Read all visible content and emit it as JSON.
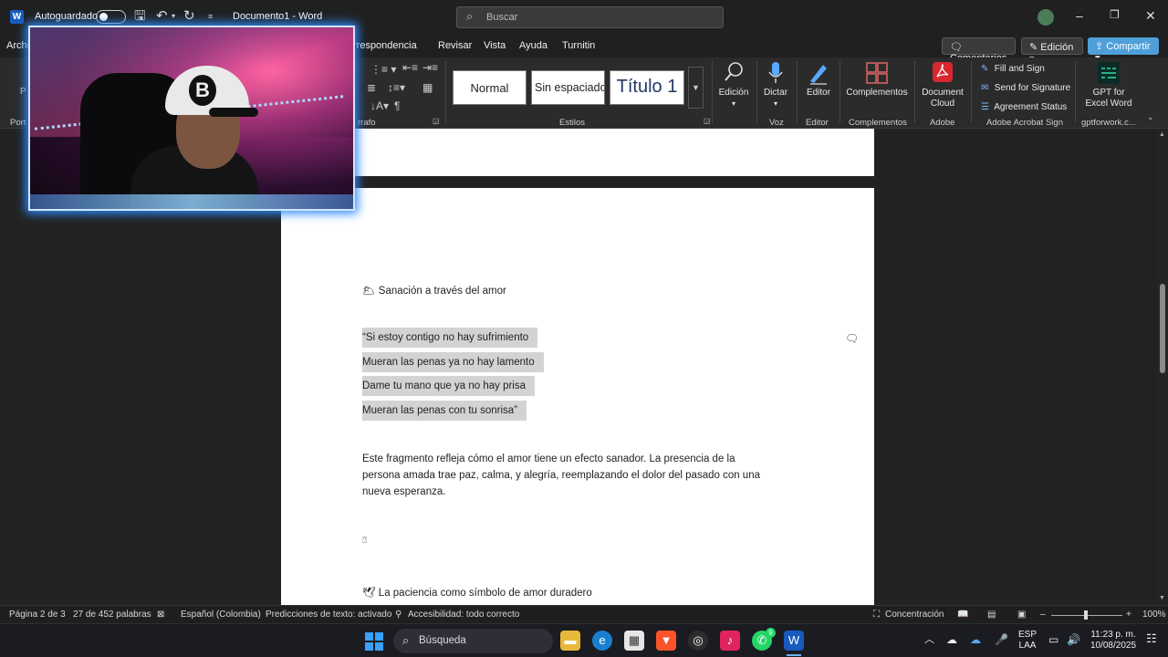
{
  "titlebar": {
    "autosave_label": "Autoguardado",
    "doc_title": "Documento1 - Word",
    "search_placeholder": "Buscar"
  },
  "menu": {
    "items": [
      "Archi",
      "rrespondencia",
      "Revisar",
      "Vista",
      "Ayuda",
      "Turnitin"
    ],
    "comments_label": "Comentarios",
    "edit_label": "Edición",
    "share_label": "Compartir"
  },
  "ribbon": {
    "left_labels": [
      "P",
      "Port"
    ],
    "paragraph_label": "rrafo",
    "styles": [
      "Normal",
      "Sin espaciado",
      "Título 1"
    ],
    "styles_label": "Estilos",
    "edicion_label": "Edición",
    "dictar_label": "Dictar",
    "voz_label": "Voz",
    "editor_label": "Editor",
    "editor_group": "Editor",
    "complementos_label": "Complementos",
    "complementos_group": "Complementos",
    "document_cloud_1": "Document",
    "document_cloud_2": "Cloud",
    "adobe_group": "Adobe",
    "fill_sign": "Fill and Sign",
    "send_signature": "Send for Signature",
    "agreement_status": "Agreement Status",
    "acrobat_group": "Adobe Acrobat Sign",
    "gpt_1": "GPT for",
    "gpt_2": "Excel Word",
    "gpt_group": "gptforwork.c..."
  },
  "document": {
    "heading1": "🌥 Sanación a través del amor",
    "quote_lines": [
      "“Si estoy contigo no hay sufrimiento",
      "Mueran las penas ya no hay lamento",
      "Dame tu mano que ya no hay prisa",
      "Mueran las penas con tu sonrisa”"
    ],
    "paragraph_lines": [
      "Este fragmento refleja cómo el amor tiene un efecto sanador. La presencia de la",
      "persona amada trae paz, calma, y alegría, reemplazando el dolor del pasado con una",
      "nueva esperanza."
    ],
    "placeholder_glyph": "⍰",
    "heading2": "🕊 La paciencia como símbolo de amor duradero"
  },
  "statusbar": {
    "page": "Página 2 de 3",
    "words": "27 de 452 palabras",
    "language": "Español (Colombia)",
    "predictions": "Predicciones de texto: activado",
    "accessibility": "Accesibilidad: todo correcto",
    "focus": "Concentración",
    "zoom": "100%"
  },
  "taskbar": {
    "search_placeholder": "Búsqueda",
    "lang_top": "ESP",
    "lang_bottom": "LAA",
    "time": "11:23 p. m.",
    "date": "10/08/2025",
    "whatsapp_badge": "9"
  },
  "colors": {
    "accent": "#4f9fd8",
    "word_blue": "#185abd",
    "highlight": "#d3d3d3"
  }
}
